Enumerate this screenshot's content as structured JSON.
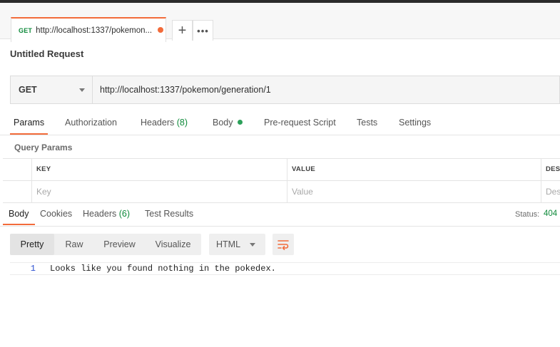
{
  "tab": {
    "method": "GET",
    "url": "http://localhost:1337/pokemon...",
    "unsaved_color": "#f26b3a"
  },
  "tab_add_icon": "+",
  "tab_more_icon": "•••",
  "request": {
    "title": "Untitled Request",
    "method": "GET",
    "url": "http://localhost:1337/pokemon/generation/1"
  },
  "request_tabs": [
    {
      "label": "Params",
      "active": true
    },
    {
      "label": "Authorization"
    },
    {
      "label": "Headers",
      "count": "(8)"
    },
    {
      "label": "Body",
      "indicator": true
    },
    {
      "label": "Pre-request Script"
    },
    {
      "label": "Tests"
    },
    {
      "label": "Settings"
    }
  ],
  "query_params": {
    "title": "Query Params",
    "headers": [
      "KEY",
      "VALUE",
      "DESC"
    ],
    "placeholders": [
      "Key",
      "Value",
      "Des"
    ]
  },
  "response_tabs": [
    {
      "label": "Body",
      "active": true
    },
    {
      "label": "Cookies"
    },
    {
      "label": "Headers",
      "count": "(6)"
    },
    {
      "label": "Test Results"
    }
  ],
  "status": {
    "label": "Status:",
    "value": "404"
  },
  "view_modes": [
    "Pretty",
    "Raw",
    "Preview",
    "Visualize"
  ],
  "format": "HTML",
  "response_body": {
    "line_number": "1",
    "text": "Looks like you found nothing in the pokedex."
  },
  "colors": {
    "accent": "#f26b3a",
    "success": "#0f8a3b",
    "line_number": "#2b4fd1"
  }
}
